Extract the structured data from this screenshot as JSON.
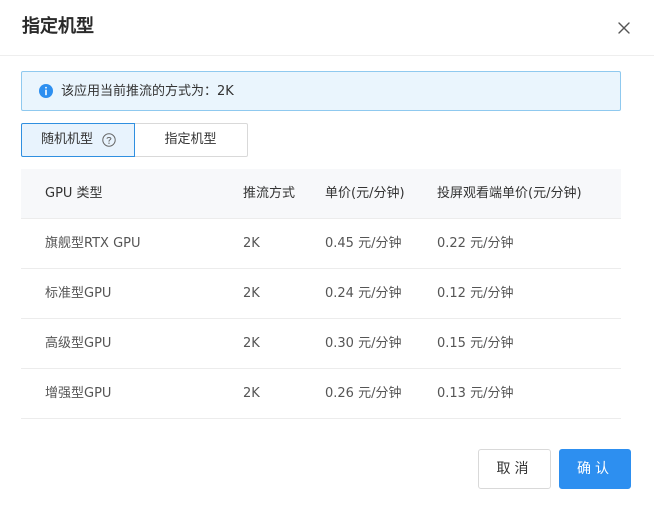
{
  "dialog": {
    "title": "指定机型",
    "close_icon": "close-icon"
  },
  "info_banner": {
    "icon": "info-icon",
    "text": "该应用当前推流的方式为：2K"
  },
  "tabs": [
    {
      "label": "随机机型",
      "icon": "help-circle-icon",
      "selected": true
    },
    {
      "label": "指定机型",
      "selected": false
    }
  ],
  "table": {
    "headers": [
      "GPU 类型",
      "推流方式",
      "单价(元/分钟)",
      "投屏观看端单价(元/分钟)"
    ],
    "rows": [
      [
        "旗舰型RTX GPU",
        "2K",
        "0.45 元/分钟",
        "0.22 元/分钟"
      ],
      [
        "标准型GPU",
        "2K",
        "0.24 元/分钟",
        "0.12 元/分钟"
      ],
      [
        "高级型GPU",
        "2K",
        "0.30 元/分钟",
        "0.15 元/分钟"
      ],
      [
        "增强型GPU",
        "2K",
        "0.26 元/分钟",
        "0.13 元/分钟"
      ]
    ]
  },
  "footer": {
    "cancel_label": "取消",
    "confirm_label": "确认"
  },
  "colors": {
    "accent": "#2d8ff0",
    "info_bg": "#eaf5fd",
    "info_border": "#8fc9ef"
  }
}
